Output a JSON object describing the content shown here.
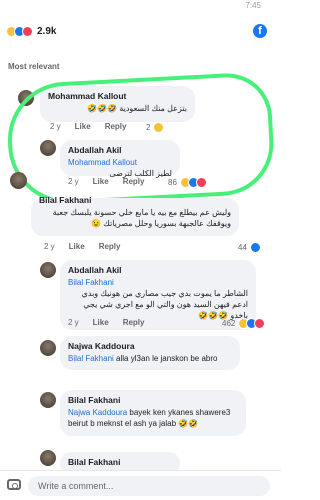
{
  "status_bar": {
    "time": "7:45"
  },
  "post_reactions": {
    "count": "2.9k",
    "icons": [
      "haha-icon",
      "like-icon",
      "love-icon"
    ]
  },
  "brand": {
    "icon": "facebook-icon",
    "color": "#1877f2"
  },
  "section_label": "Most relevant",
  "highlight_color": "#47f07a",
  "comments": [
    {
      "author": "Mohammad Kallout",
      "text": "بتزعل منك السعودية 🤣🤣🤣",
      "time": "2 y",
      "like_label": "Like",
      "reply_label": "Reply",
      "reactions": "2"
    },
    {
      "author": "Abdallah Akil",
      "mention": "Mohammad Kallout",
      "text": "لطيز الكلب لترضى",
      "time": "2 y",
      "like_label": "Like",
      "reply_label": "Reply",
      "reactions": "86"
    },
    {
      "author": "Bilal Fakhani",
      "text": "وليش عم بيطلع مع بيه يا مابع خلي حسونة يلبسك جعبة ويوقفك عالجبهة بسوريا وحلل مصرياتك 😉",
      "time": "2 y",
      "like_label": "Like",
      "reply_label": "Reply",
      "reactions": "44"
    },
    {
      "author": "Abdallah Akil",
      "mention": "Bilal Fakhani",
      "text": "الشاطر ما يموت بدي جيب مصاري من هونيك وبدي ادعم فيهن السيد هون والتي الو مع اجري شي يجي باخدو 🤣🤣🤣",
      "time": "2 y",
      "like_label": "Like",
      "reply_label": "Reply",
      "reactions": "462"
    },
    {
      "author": "Najwa Kaddoura",
      "mention": "Bilal Fakhani",
      "text": "alla yl3an le janskon  be abro",
      "time": "",
      "like_label": "",
      "reply_label": "",
      "reactions": ""
    },
    {
      "author": "Bilal Fakhani",
      "mention": "Najwa Kaddoura",
      "text": "bayek ken ykanes shawere3 beirut b meknst el ash ya jalab 🤣🤣",
      "time": "",
      "like_label": "",
      "reply_label": "",
      "reactions": ""
    },
    {
      "author": "Bilal Fakhani",
      "text": "",
      "time": "",
      "like_label": "",
      "reply_label": "",
      "reactions": ""
    }
  ],
  "composer": {
    "placeholder": "Write a comment..."
  }
}
